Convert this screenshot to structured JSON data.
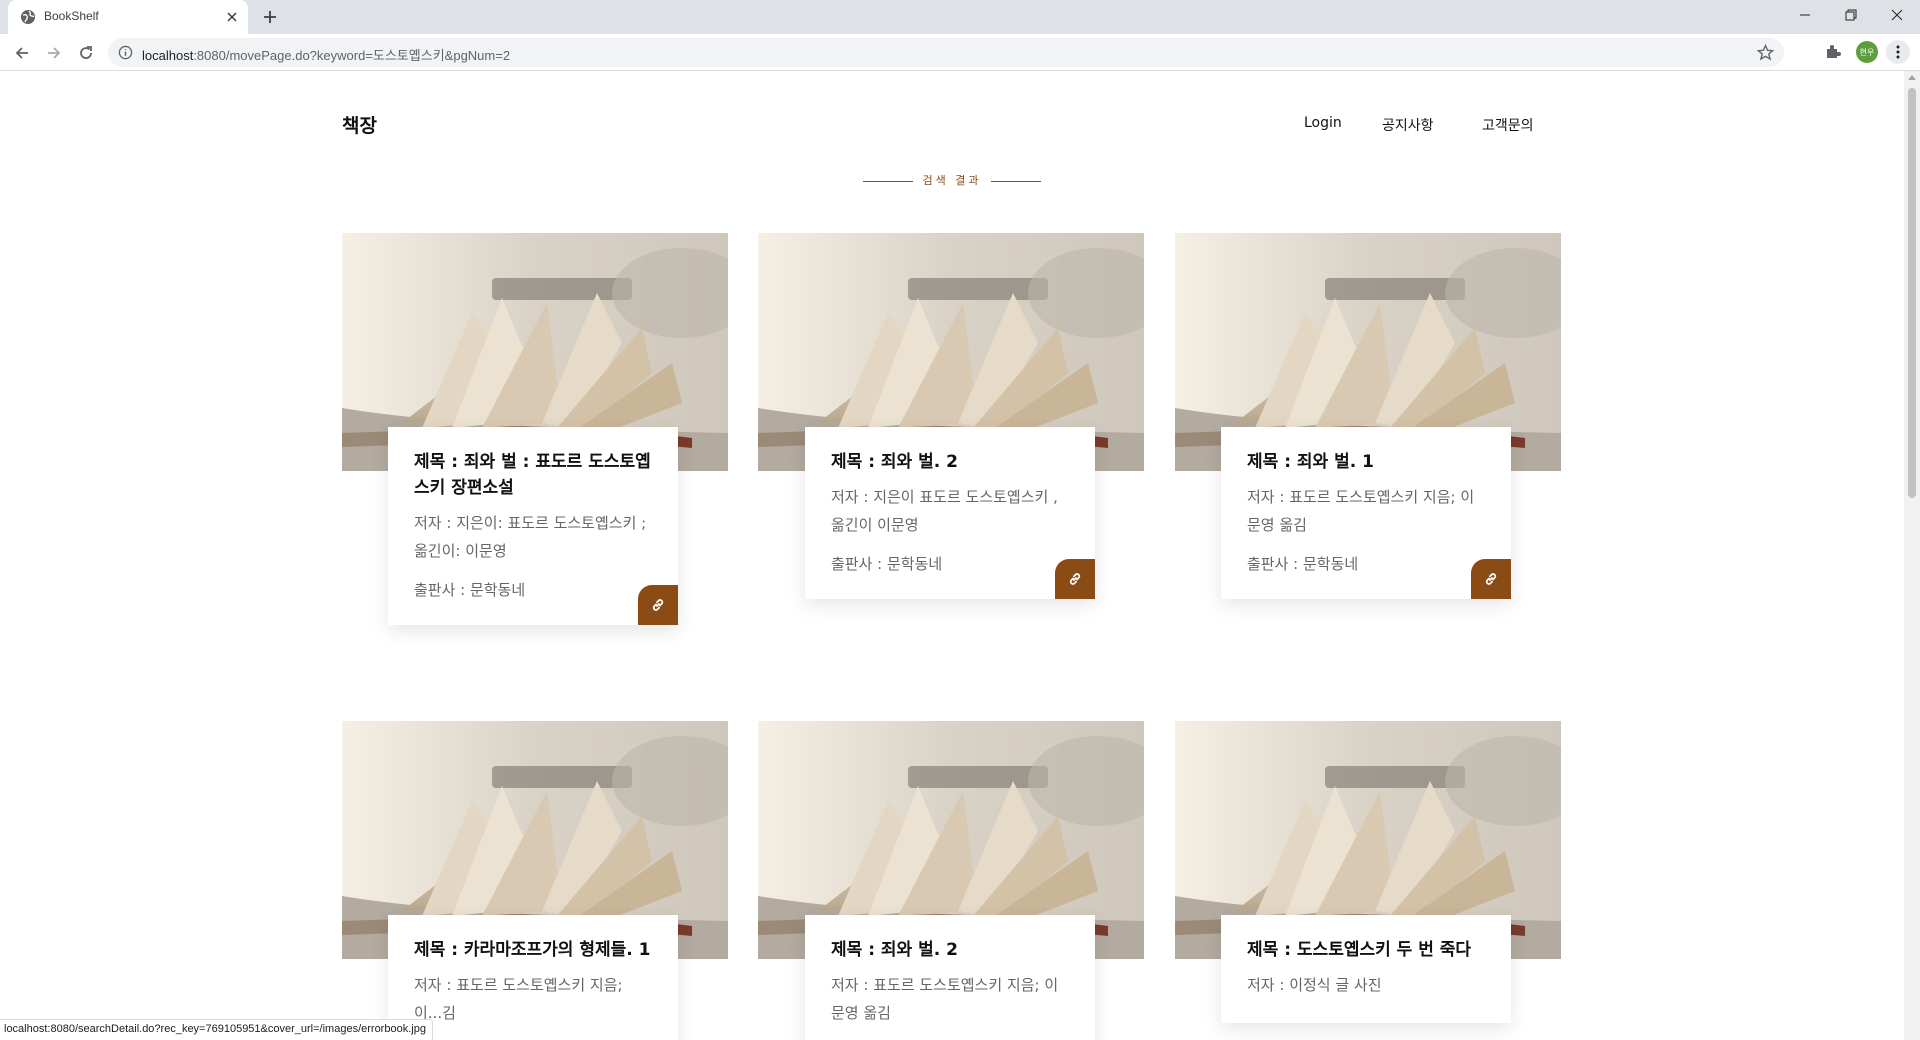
{
  "browser": {
    "tab_title": "BookShelf",
    "url_host": "localhost",
    "url_rest": ":8080/movePage.do?keyword=도스토옙스키&pgNum=2",
    "profile_label": "현우",
    "status_url": "localhost:8080/searchDetail.do?rec_key=769105951&cover_url=/images/errorbook.jpg"
  },
  "header": {
    "brand": "책장",
    "nav": [
      "Login",
      "공지사항",
      "고객문의"
    ]
  },
  "section": {
    "title": "검색 결과"
  },
  "colors": {
    "accent": "#8a4b14"
  },
  "books": [
    {
      "title": "제목 : 죄와 벌 : 표도르 도스토옙스키 장편소설",
      "author": "저자 : 지은이: 표도르 도스토옙스키 ;옮긴이: 이문영",
      "publisher": "출판사 : 문학동네"
    },
    {
      "title": "제목 : 죄와 벌. 2",
      "author": "저자 : 지은이 표도르 도스토옙스키 ,옮긴이 이문영",
      "publisher": "출판사 : 문학동네"
    },
    {
      "title": "제목 : 죄와 벌. 1",
      "author": "저자 : 표도르 도스토옙스키 지음; 이문영 옮김",
      "publisher": "출판사 : 문학동네"
    },
    {
      "title": "제목 : 카라마조프가의 형제들. 1",
      "author": "저자 : 표도르 도스토옙스키 지음; 이...김",
      "publisher": ""
    },
    {
      "title": "제목 : 죄와 벌. 2",
      "author": "저자 : 표도르 도스토옙스키 지음; 이문영 옮김",
      "publisher": ""
    },
    {
      "title": "제목 : 도스토옙스키 두 번 죽다",
      "author": "저자 : 이정식 글 사진",
      "publisher": ""
    }
  ]
}
